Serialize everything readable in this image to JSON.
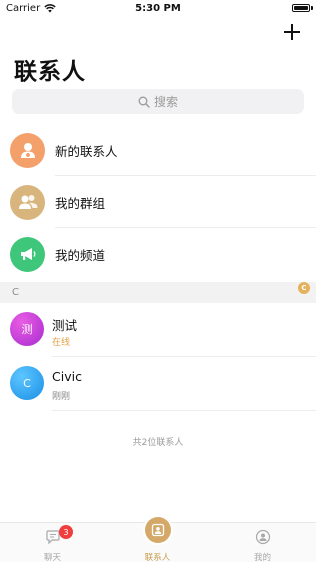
{
  "status_bar": {
    "carrier": "Carrier",
    "time": "5:30 PM"
  },
  "header": {
    "title": "联系人",
    "add_icon": "plus-icon"
  },
  "search": {
    "placeholder": "搜索",
    "icon": "search-icon"
  },
  "menu": [
    {
      "label": "新的联系人",
      "icon": "person-plus-icon",
      "color": "#f4a06a"
    },
    {
      "label": "我的群组",
      "icon": "group-icon",
      "color": "#d8b57d"
    },
    {
      "label": "我的频道",
      "icon": "megaphone-icon",
      "color": "#3ec77b"
    }
  ],
  "section": {
    "letter": "C",
    "index_badge": "C"
  },
  "contacts": [
    {
      "name": "测试",
      "avatar_text": "测",
      "status": "在线",
      "status_color": "#e0a24a",
      "avatar_color": "#c23ad6"
    },
    {
      "name": "Civic",
      "avatar_text": "C",
      "status": "刚刚",
      "status_color": "#8a8a8a",
      "avatar_color": "#2ea6f0"
    }
  ],
  "footer": {
    "count_text": "共2位联系人"
  },
  "tabs": [
    {
      "label": "聊天",
      "icon": "chat-icon",
      "badge": "3"
    },
    {
      "label": "联系人",
      "icon": "contacts-icon",
      "active": true
    },
    {
      "label": "我的",
      "icon": "profile-icon"
    }
  ],
  "colors": {
    "accent": "#c79a4e",
    "badge": "#f03e3e"
  }
}
